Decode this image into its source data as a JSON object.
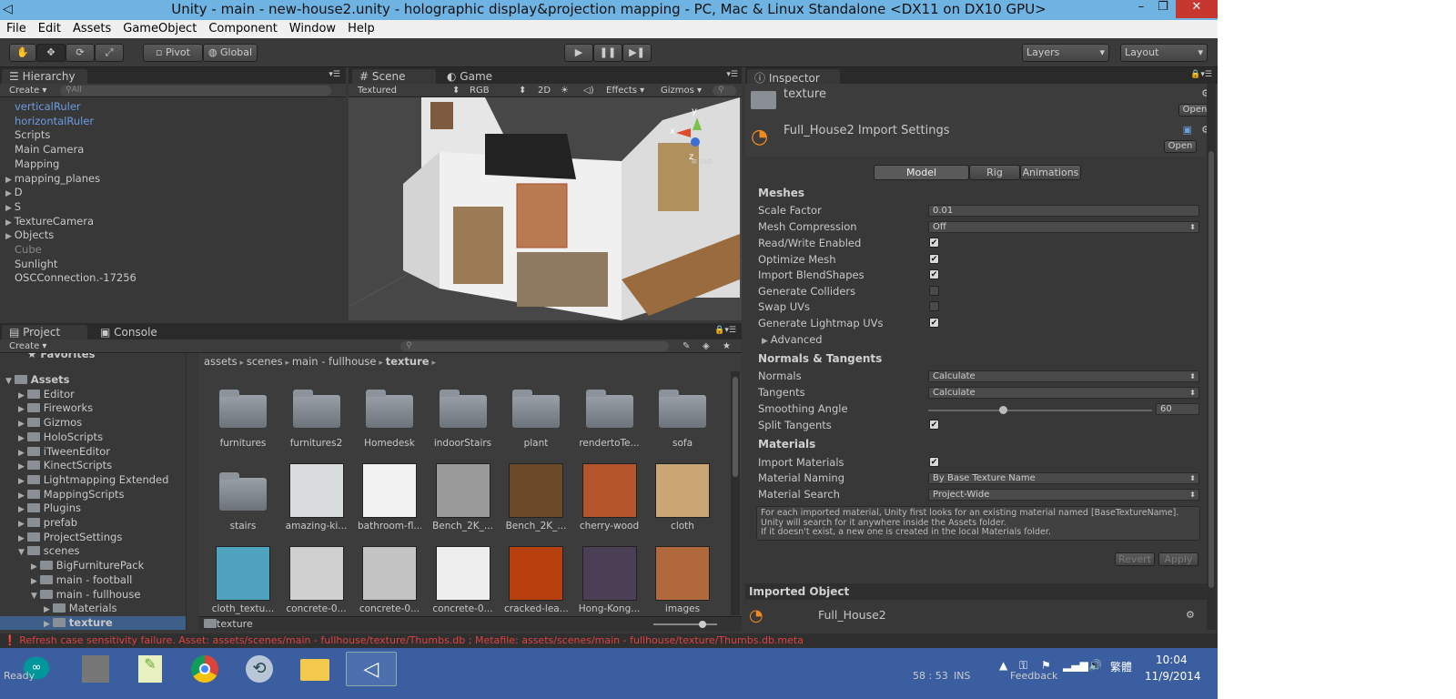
{
  "window": {
    "title": "Unity - main - new-house2.unity - holographic display&projection mapping - PC, Mac & Linux Standalone <DX11 on DX10 GPU>",
    "min": "–",
    "max": "❐",
    "close": "✕"
  },
  "menu": [
    "File",
    "Edit",
    "Assets",
    "GameObject",
    "Component",
    "Window",
    "Help"
  ],
  "toolbar": {
    "pivot": "Pivot",
    "global": "Global",
    "layers": "Layers",
    "layout": "Layout",
    "play": "▶",
    "pause": "❚❚",
    "step": "▶❚"
  },
  "hierarchy": {
    "tab": "Hierarchy",
    "create": "Create",
    "search_placeholder": "All",
    "items": [
      {
        "label": "verticalRuler",
        "style": "blue",
        "expand": false
      },
      {
        "label": "horizontalRuler",
        "style": "blue",
        "expand": false
      },
      {
        "label": "Scripts",
        "style": "normal",
        "expand": false
      },
      {
        "label": "Main Camera",
        "style": "normal",
        "expand": false
      },
      {
        "label": "Mapping",
        "style": "normal",
        "expand": false
      },
      {
        "label": "mapping_planes",
        "style": "normal",
        "expand": true
      },
      {
        "label": "D",
        "style": "normal",
        "expand": true
      },
      {
        "label": "S",
        "style": "normal",
        "expand": true
      },
      {
        "label": "TextureCamera",
        "style": "normal",
        "expand": true
      },
      {
        "label": "Objects",
        "style": "normal",
        "expand": true
      },
      {
        "label": "Cube",
        "style": "grey",
        "expand": false
      },
      {
        "label": "Sunlight",
        "style": "normal",
        "expand": false
      },
      {
        "label": "OSCConnection.-17256",
        "style": "normal",
        "expand": false
      }
    ]
  },
  "scene": {
    "tab_scene": "Scene",
    "tab_game": "Game",
    "shading": "Textured",
    "rgb": "RGB",
    "mode2d": "2D",
    "effects": "Effects",
    "gizmos": "Gizmos",
    "iso": "Iso",
    "axis_y": "y",
    "axis_x": "x",
    "axis_z": "z"
  },
  "project": {
    "tab": "Project",
    "console_tab": "Console",
    "create": "Create",
    "favorites": "Favorites",
    "tree": [
      {
        "label": "Assets",
        "indent": 0,
        "bold": true,
        "open": true
      },
      {
        "label": "Editor",
        "indent": 1
      },
      {
        "label": "Fireworks",
        "indent": 1
      },
      {
        "label": "Gizmos",
        "indent": 1
      },
      {
        "label": "HoloScripts",
        "indent": 1
      },
      {
        "label": "iTweenEditor",
        "indent": 1
      },
      {
        "label": "KinectScripts",
        "indent": 1
      },
      {
        "label": "Lightmapping Extended",
        "indent": 1
      },
      {
        "label": "MappingScripts",
        "indent": 1
      },
      {
        "label": "Plugins",
        "indent": 1
      },
      {
        "label": "prefab",
        "indent": 1
      },
      {
        "label": "ProjectSettings",
        "indent": 1
      },
      {
        "label": "scenes",
        "indent": 1,
        "open": true
      },
      {
        "label": "BigFurniturePack",
        "indent": 2
      },
      {
        "label": "main - football",
        "indent": 2
      },
      {
        "label": "main - fullhouse",
        "indent": 2,
        "open": true
      },
      {
        "label": "Materials",
        "indent": 3
      },
      {
        "label": "texture",
        "indent": 3,
        "bold": true,
        "selected": true
      }
    ],
    "breadcrumb": [
      "assets",
      "scenes",
      "main - fullhouse",
      "texture"
    ],
    "assets": [
      {
        "label": "furnitures",
        "kind": "folder"
      },
      {
        "label": "furnitures2",
        "kind": "folder"
      },
      {
        "label": "Homedesk",
        "kind": "folder"
      },
      {
        "label": "indoorStairs",
        "kind": "folder"
      },
      {
        "label": "plant",
        "kind": "folder"
      },
      {
        "label": "renderto​Te...",
        "kind": "folder"
      },
      {
        "label": "sofa",
        "kind": "folder"
      },
      {
        "label": "stairs",
        "kind": "folder"
      },
      {
        "label": "amazing-ki...",
        "kind": "tex",
        "color": "#d8dcdc"
      },
      {
        "label": "bathroom-fl...",
        "kind": "tex",
        "color": "#f2f2f2"
      },
      {
        "label": "Bench_2K_...",
        "kind": "tex",
        "color": "#9a9a9a"
      },
      {
        "label": "Bench_2K_...",
        "kind": "tex",
        "color": "#6b4a2a"
      },
      {
        "label": "cherry-wood",
        "kind": "tex",
        "color": "#b4552c"
      },
      {
        "label": "cloth",
        "kind": "tex",
        "color": "#c9a674"
      },
      {
        "label": "cloth_textu...",
        "kind": "tex",
        "color": "#4fa3bf"
      },
      {
        "label": "concrete-0...",
        "kind": "tex",
        "color": "#d0d0d0"
      },
      {
        "label": "concrete-0...",
        "kind": "tex",
        "color": "#c4c4c4"
      },
      {
        "label": "concrete-0...",
        "kind": "tex",
        "color": "#eeeeee"
      },
      {
        "label": "cracked-lea...",
        "kind": "tex",
        "color": "#b8400f"
      },
      {
        "label": "Hong-Kong...",
        "kind": "tex",
        "color": "#4a3f55"
      },
      {
        "label": "images",
        "kind": "tex",
        "color": "#b0683c"
      }
    ],
    "footer_folder": "texture"
  },
  "inspector": {
    "tab": "Inspector",
    "asset_name": "texture",
    "open": "Open",
    "import_title": "Full_House2 Import Settings",
    "tabs": [
      "Model",
      "Rig",
      "Animations"
    ],
    "meshes_header": "Meshes",
    "scale_factor_label": "Scale Factor",
    "scale_factor": "0.01",
    "mesh_compression_label": "Mesh Compression",
    "mesh_compression": "Off",
    "checks": [
      {
        "label": "Read/Write Enabled",
        "checked": true
      },
      {
        "label": "Optimize Mesh",
        "checked": true
      },
      {
        "label": "Import BlendShapes",
        "checked": true
      },
      {
        "label": "Generate Colliders",
        "checked": false
      },
      {
        "label": "Swap UVs",
        "checked": false
      },
      {
        "label": "Generate Lightmap UVs",
        "checked": true
      }
    ],
    "advanced": "Advanced",
    "normals_header": "Normals & Tangents",
    "normals_label": "Normals",
    "normals": "Calculate",
    "tangents_label": "Tangents",
    "tangents": "Calculate",
    "smoothing_label": "Smoothing Angle",
    "smoothing": "60",
    "smoothing_fraction": 0.333,
    "split_label": "Split Tangents",
    "materials_header": "Materials",
    "import_materials_label": "Import Materials",
    "naming_label": "Material Naming",
    "naming": "By Base Texture Name",
    "search_label": "Material Search",
    "search": "Project-Wide",
    "help": [
      "For each imported material, Unity first looks for an existing material named [BaseTextureName].",
      "Unity will search for it anywhere inside the Assets folder.",
      "If it doesn't exist, a new one is created in the local Materials folder."
    ],
    "revert": "Revert",
    "apply": "Apply",
    "imported_header": "Imported Object",
    "imported_name": "Full_House2"
  },
  "status": {
    "error": "Refresh case sensitivity failure. Asset: assets/scenes/main - fullhouse/texture/Thumbs.db ; Metafile: assets/scenes/main - fullhouse/texture/Thumbs.db.meta",
    "coords": "58 : 53",
    "ins": "INS",
    "feedback": "Feedback",
    "ready": "Ready"
  },
  "clock": {
    "time": "10:04",
    "date": "11/9/2014",
    "lang": "繁體"
  }
}
